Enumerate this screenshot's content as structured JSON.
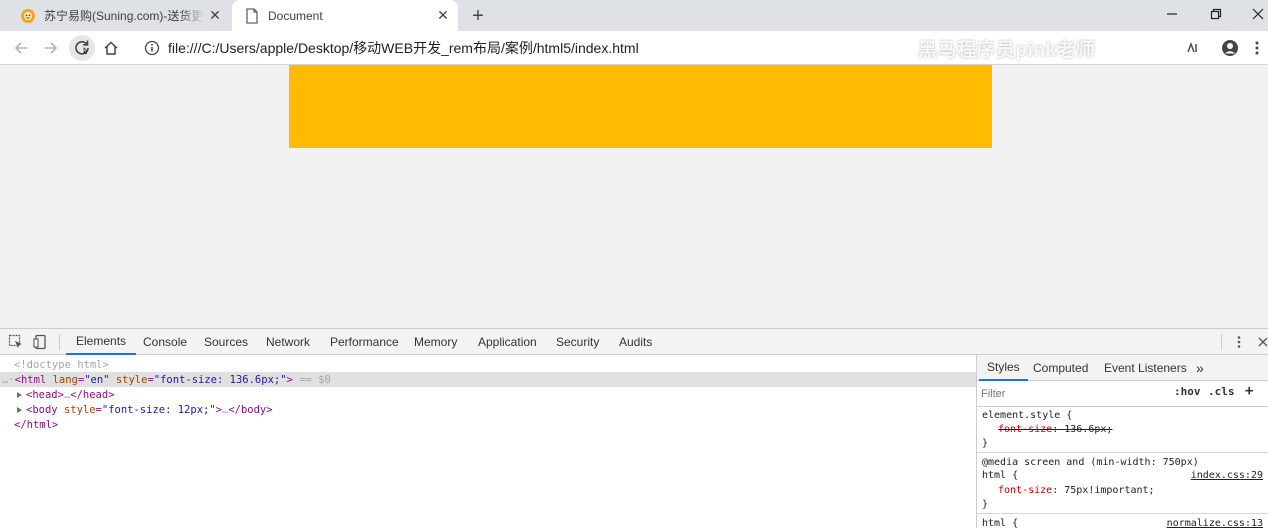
{
  "colors": {
    "page_box": "#ffbb00",
    "tab_active_bg": "#ffffff",
    "tabstrip_bg": "#dee1e6",
    "devtools_accent": "#1a73e8"
  },
  "browser": {
    "tabs": [
      {
        "title": "苏宁易购(Suning.com)-送货更准",
        "favicon": "suning-lion-icon",
        "active": false
      },
      {
        "title": "Document",
        "favicon": "document-icon",
        "active": true
      }
    ],
    "new_tab_icon": "plus-icon",
    "window_controls": [
      "minimize-icon",
      "restore-icon",
      "close-icon"
    ],
    "address": "file:///C:/Users/apple/Desktop/移动WEB开发_rem布局/案例/html5/index.html",
    "watermark": "黑马程序员pink老师"
  },
  "devtools": {
    "tabs": [
      "Elements",
      "Console",
      "Sources",
      "Network",
      "Performance",
      "Memory",
      "Application",
      "Security",
      "Audits"
    ],
    "active_tab": "Elements",
    "elements": {
      "doctype": "<!doctype html>",
      "html_open": {
        "ellipsis": "…",
        "tag_open": "<html",
        "attr1": "lang",
        "val1": "\"en\"",
        "attr2": "style",
        "val2": "\"font-size: 136.6px;\"",
        "tag_close": ">",
        "marker": "== $0"
      },
      "head": {
        "tag_open": "<head>",
        "ellipsis": "…",
        "tag_close": "</head>"
      },
      "body": {
        "tag_open": "<body",
        "attr": "style",
        "val": "\"font-size: 12px;\"",
        "tag_mid": ">",
        "ellipsis": "…",
        "tag_close": "</body>"
      },
      "html_close": "</html>"
    },
    "styles_panel": {
      "tabs": [
        "Styles",
        "Computed",
        "Event Listeners"
      ],
      "active_tab": "Styles",
      "more": "»",
      "filter_placeholder": "Filter",
      "hov": ":hov",
      "cls": ".cls",
      "add": "+",
      "rules": [
        {
          "selector": "element.style {",
          "prop": "font-size",
          "value": "136.6px;",
          "struck": true,
          "close": "}"
        },
        {
          "media": "@media screen and (min-width: 750px)",
          "selector": "html {",
          "source": "index.css:29",
          "prop": "font-size",
          "value": "75px!important;",
          "close": "}"
        },
        {
          "selector": "html {",
          "source": "normalize.css:13"
        }
      ]
    }
  }
}
